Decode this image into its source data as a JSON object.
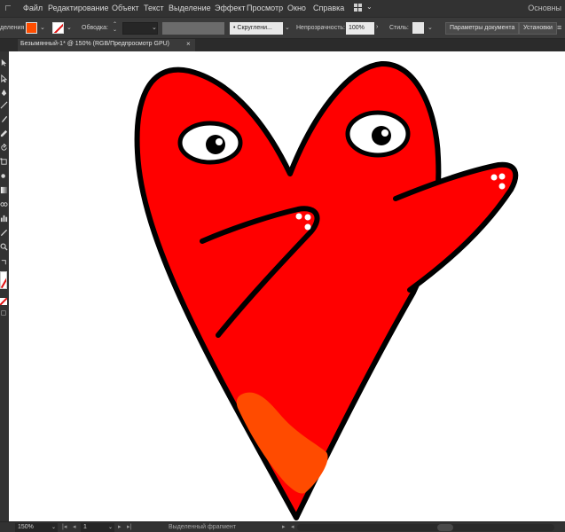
{
  "menubar": {
    "items": [
      "Файл",
      "Редактирование",
      "Объект",
      "Текст",
      "Выделение",
      "Эффект",
      "Просмотр",
      "Окно",
      "Справка"
    ],
    "workspace": "Основны"
  },
  "controlbar": {
    "selection_label": "деления",
    "fill_color": "#ff4d00",
    "stroke_label": "Обводка:",
    "style_button": "Скруглени...",
    "opacity_label": "Непрозрачность:",
    "opacity_value": "100%",
    "styles_label": "Стиль:",
    "doc_settings_button": "Параметры документа",
    "preferences_button": "Установки"
  },
  "tab": {
    "title": "Безымянный-1* @ 150% (RGB/Предпросмотр GPU)",
    "close": "×"
  },
  "toolbar": {
    "tools": [
      "selection-tool-icon",
      "direct-selection-tool-icon",
      "pen-tool-icon",
      "line-tool-icon",
      "paintbrush-tool-icon",
      "pencil-tool-icon",
      "eraser-tool-icon",
      "rotate-tool-icon",
      "scale-tool-icon",
      "warp-tool-icon",
      "free-transform-tool-icon",
      "shape-builder-tool-icon",
      "gradient-tool-icon",
      "blend-tool-icon",
      "symbol-sprayer-tool-icon",
      "column-graph-tool-icon",
      "eyedropper-tool-icon",
      "zoom-tool-icon",
      "swap-fill-stroke-icon"
    ]
  },
  "artwork": {
    "heart_fill": "#ff0000",
    "highlight_fill": "#ff4b00",
    "outline_color": "#000000"
  },
  "statusbar": {
    "zoom": "150%",
    "page": "1",
    "status_text": "Выделенный фрагмент"
  }
}
